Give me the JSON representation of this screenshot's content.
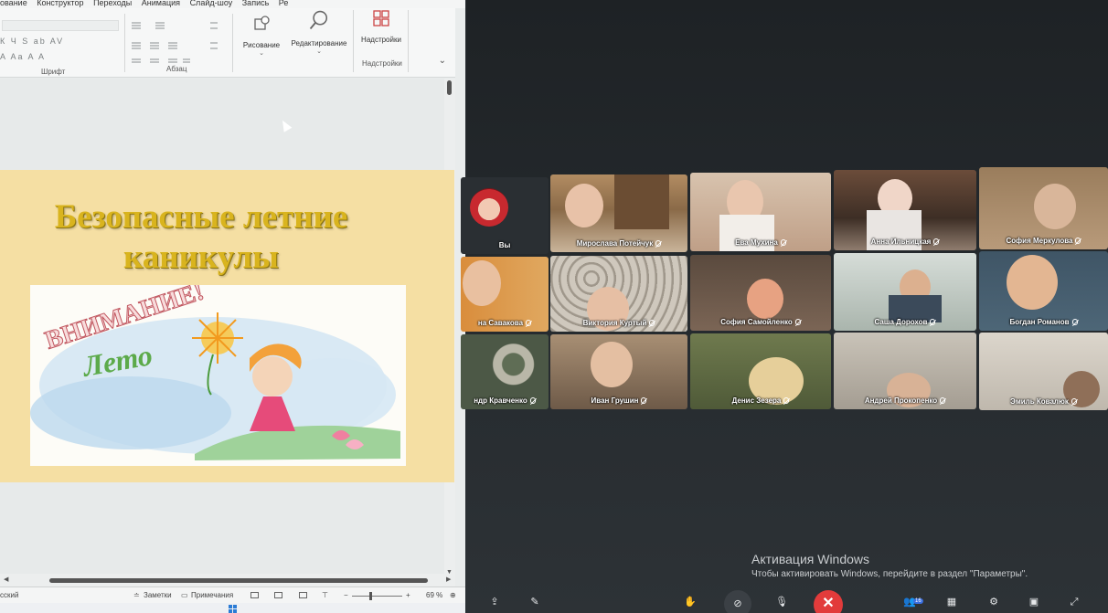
{
  "ppt": {
    "tabs": [
      "ование",
      "Конструктор",
      "Переходы",
      "Анимация",
      "Слайд-шоу",
      "Запись",
      "Ре"
    ],
    "groups": {
      "font": "Шрифт",
      "paragraph": "Абзац",
      "addins": "Надстройки"
    },
    "buttons": {
      "drawing": "Рисование",
      "editing": "Редактирование",
      "addins": "Надстройки"
    },
    "font_controls": "К Ч S ab AV",
    "font_controls2": "A Aa A A",
    "slide": {
      "title_line1": "Безопасные  летние",
      "title_line2": "каникулы",
      "pic_text1": "ВНИМАНИЕ!",
      "pic_text2": "Лето"
    },
    "status": {
      "language": "сский",
      "notes": "Заметки",
      "comments": "Примечания",
      "zoom": "69 %"
    }
  },
  "conference": {
    "participants": [
      {
        "name": "Вы",
        "self": true
      },
      {
        "name": "Мирослава Потейчук"
      },
      {
        "name": "Ева Мухина"
      },
      {
        "name": "Анна Ильницкая"
      },
      {
        "name": "София Меркулова"
      },
      {
        "name": "на Савакова"
      },
      {
        "name": "Виктория Куртый"
      },
      {
        "name": "София Самойленко"
      },
      {
        "name": "Саша Дорохов"
      },
      {
        "name": "Богдан Романов"
      },
      {
        "name": "ндр Кравченко"
      },
      {
        "name": "Иван Грушин"
      },
      {
        "name": "Денис Зезера"
      },
      {
        "name": "Андрей Прокопенко"
      },
      {
        "name": "Эмиль Ковалюк"
      }
    ],
    "participants_count": "16",
    "activation": {
      "title": "Активация Windows",
      "subtitle": "Чтобы активировать Windows, перейдите в раздел \"Параметры\"."
    },
    "colors": {
      "background": "#1f2428",
      "leave_button": "#e23b3b"
    }
  }
}
